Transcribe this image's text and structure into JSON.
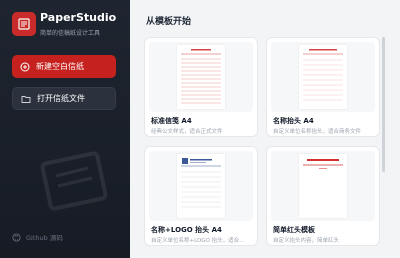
{
  "app": {
    "title": "PaperStudio",
    "subtitle": "简单的信稿纸设计工具"
  },
  "sidebar": {
    "new_button": "新建空白信纸",
    "open_button": "打开信纸文件",
    "github_link": "Github 源码"
  },
  "main": {
    "section_title": "从模板开始",
    "templates": [
      {
        "title": "标准信笺 A4",
        "desc": "经典公文样式，适合正式文件"
      },
      {
        "title": "名称抬头 A4",
        "desc": "自定义单位名称抬头，适合商务文件"
      },
      {
        "title": "名称+LOGO 抬头 A4",
        "desc": "自定义单位名称+LOGO 抬头，适合..."
      },
      {
        "title": "简单红头模板",
        "desc": "自定义抬头内容，简单红头"
      }
    ]
  },
  "colors": {
    "accent": "#c5221f",
    "sidebar_bg": "#1f2530"
  }
}
